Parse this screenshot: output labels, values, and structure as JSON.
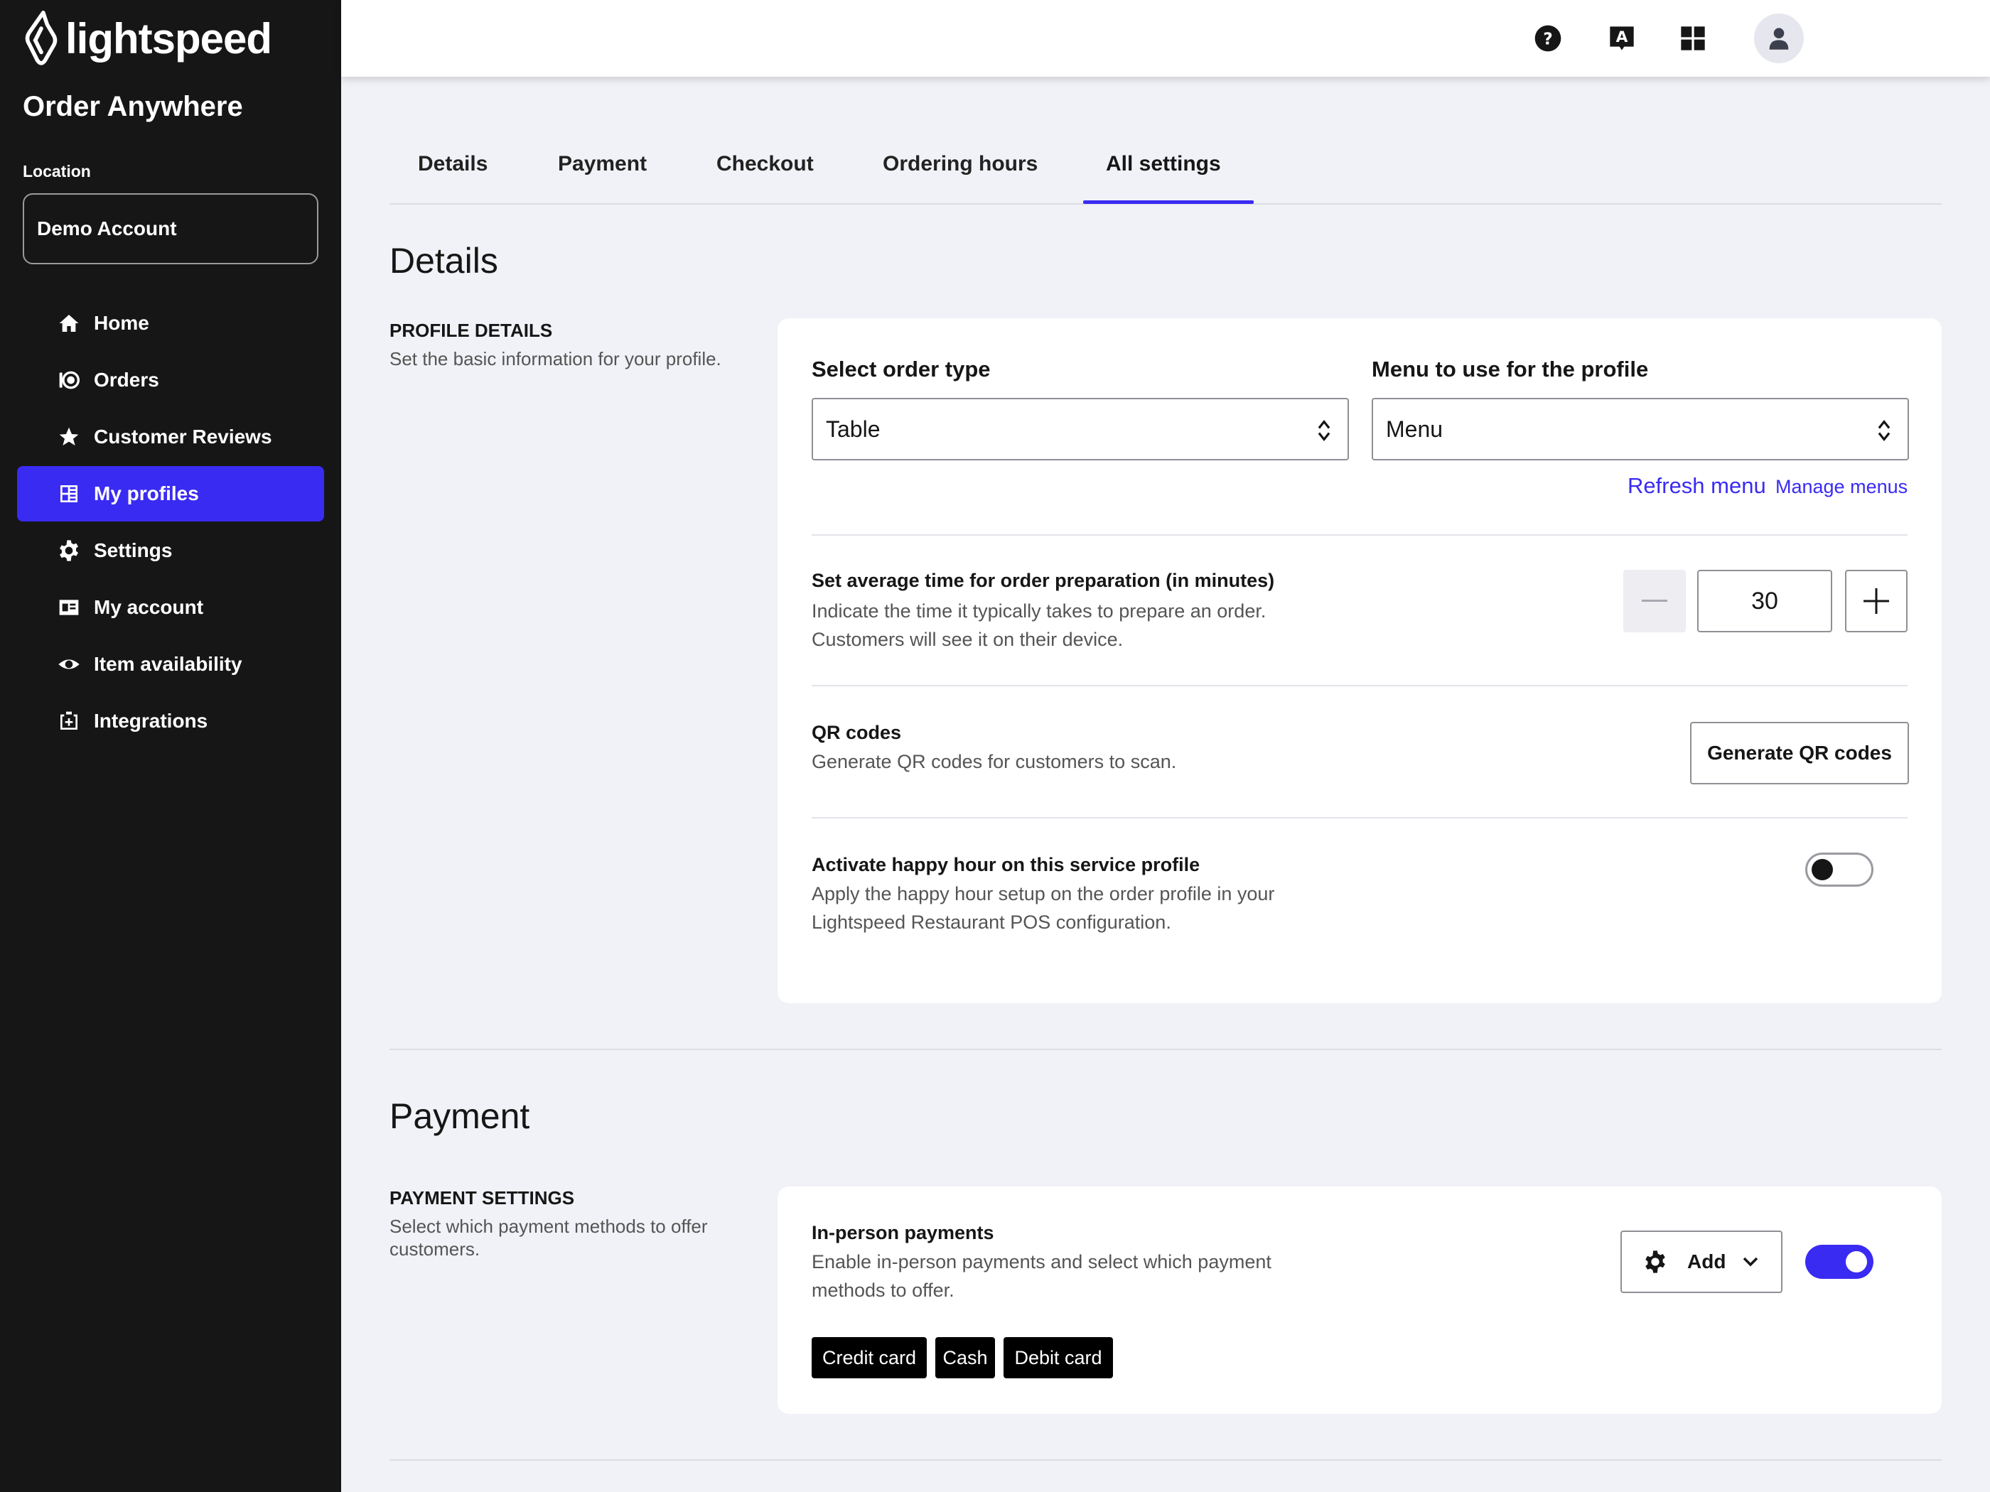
{
  "brand": {
    "name": "lightspeed",
    "app_title": "Order Anywhere"
  },
  "location": {
    "label": "Location",
    "value": "Demo Account"
  },
  "sidebar": {
    "items": [
      {
        "label": "Home",
        "icon": "home-icon"
      },
      {
        "label": "Orders",
        "icon": "orders-icon"
      },
      {
        "label": "Customer Reviews",
        "icon": "star-icon"
      },
      {
        "label": "My profiles",
        "icon": "profiles-icon",
        "active": true
      },
      {
        "label": "Settings",
        "icon": "gear-icon"
      },
      {
        "label": "My account",
        "icon": "id-card-icon"
      },
      {
        "label": "Item availability",
        "icon": "eye-icon"
      },
      {
        "label": "Integrations",
        "icon": "integrations-icon"
      }
    ]
  },
  "topbar": {
    "icons": [
      "help-icon",
      "language-icon",
      "apps-grid-icon",
      "user-icon"
    ]
  },
  "tabs": [
    {
      "label": "Details"
    },
    {
      "label": "Payment"
    },
    {
      "label": "Checkout"
    },
    {
      "label": "Ordering hours"
    },
    {
      "label": "All settings",
      "active": true
    }
  ],
  "details": {
    "title": "Details",
    "side_heading": "PROFILE DETAILS",
    "side_desc": "Set the basic information for your profile.",
    "order_type": {
      "label": "Select order type",
      "value": "Table"
    },
    "menu": {
      "label": "Menu to use for the profile",
      "value": "Menu"
    },
    "refresh_menu": "Refresh menu",
    "manage_menus": "Manage menus",
    "prep_time": {
      "title": "Set average time for order preparation (in minutes)",
      "desc_line1": "Indicate the time it typically takes to prepare an order.",
      "desc_line2": "Customers will see it on their device.",
      "value": "30"
    },
    "qr": {
      "title": "QR codes",
      "desc": "Generate QR codes for customers to scan.",
      "button": "Generate QR codes"
    },
    "happy_hour": {
      "title": "Activate happy hour on this service profile",
      "desc_line1": "Apply the happy hour setup on the order profile in your",
      "desc_line2": "Lightspeed Restaurant POS configuration.",
      "enabled": false
    }
  },
  "payment": {
    "title": "Payment",
    "side_heading": "PAYMENT SETTINGS",
    "side_desc": "Select which payment methods to offer customers.",
    "in_person": {
      "title": "In-person payments",
      "desc_line1": "Enable in-person payments and select which payment",
      "desc_line2": "methods to offer.",
      "add_label": "Add",
      "enabled": true,
      "methods": [
        "Credit card",
        "Cash",
        "Debit card"
      ]
    }
  },
  "colors": {
    "accent": "#3a2bf2",
    "sidebar_bg": "#161616",
    "page_bg": "#f1f2f7"
  }
}
